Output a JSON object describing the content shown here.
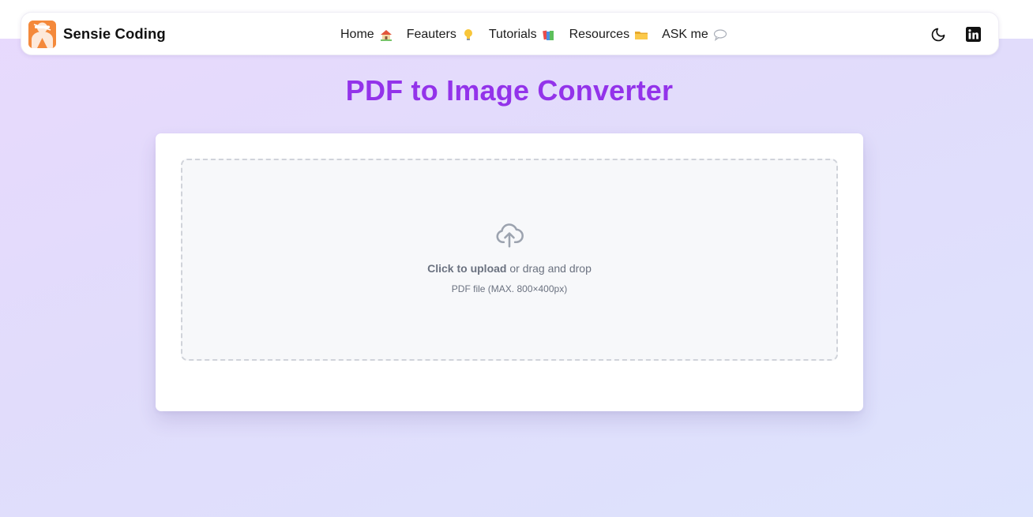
{
  "navbar": {
    "brand": "Sensie Coding",
    "links": [
      {
        "label": "Home",
        "icon": "house-emoji"
      },
      {
        "label": "Feauters",
        "icon": "lightbulb-emoji"
      },
      {
        "label": "Tutorials",
        "icon": "books-emoji"
      },
      {
        "label": "Resources",
        "icon": "folder-emoji"
      },
      {
        "label": "ASK me",
        "icon": "speech-bubble-emoji"
      }
    ],
    "actions": [
      {
        "icon": "moon-icon"
      },
      {
        "icon": "linkedin-icon"
      }
    ]
  },
  "main": {
    "title": "PDF to Image Converter",
    "upload": {
      "action_label": "Click to upload",
      "action_rest": " or drag and drop",
      "hint": "PDF file (MAX. 800×400px)",
      "icon": "cloud-upload-icon"
    }
  },
  "colors": {
    "accent": "#9333ea",
    "logo": "#f4893b",
    "dropzone_border": "#d0d3da"
  }
}
